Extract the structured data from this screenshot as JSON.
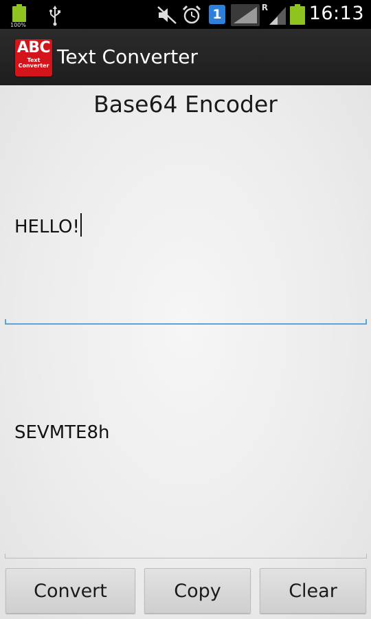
{
  "status_bar": {
    "battery_percent": "100%",
    "time": "16:13",
    "sim_badge": "1",
    "roaming_indicator": "R",
    "icons": [
      "battery-icon",
      "usb-icon",
      "mute-icon",
      "alarm-icon",
      "sim-icon",
      "signal-icon",
      "signal-roaming-icon",
      "battery-icon"
    ],
    "battery_color": "#8fc31f",
    "sim_color": "#2e7fd9"
  },
  "action_bar": {
    "icon_text_main": "ABC",
    "icon_text_sub": "Text Converter",
    "title": "Text Converter",
    "icon_color": "#d3141a"
  },
  "main": {
    "heading": "Base64 Encoder",
    "input_value": "HELLO!",
    "output_value": "SEVMTE8h",
    "focus_color": "#5aa4d6"
  },
  "buttons": {
    "convert": "Convert",
    "copy": "Copy",
    "clear": "Clear"
  }
}
